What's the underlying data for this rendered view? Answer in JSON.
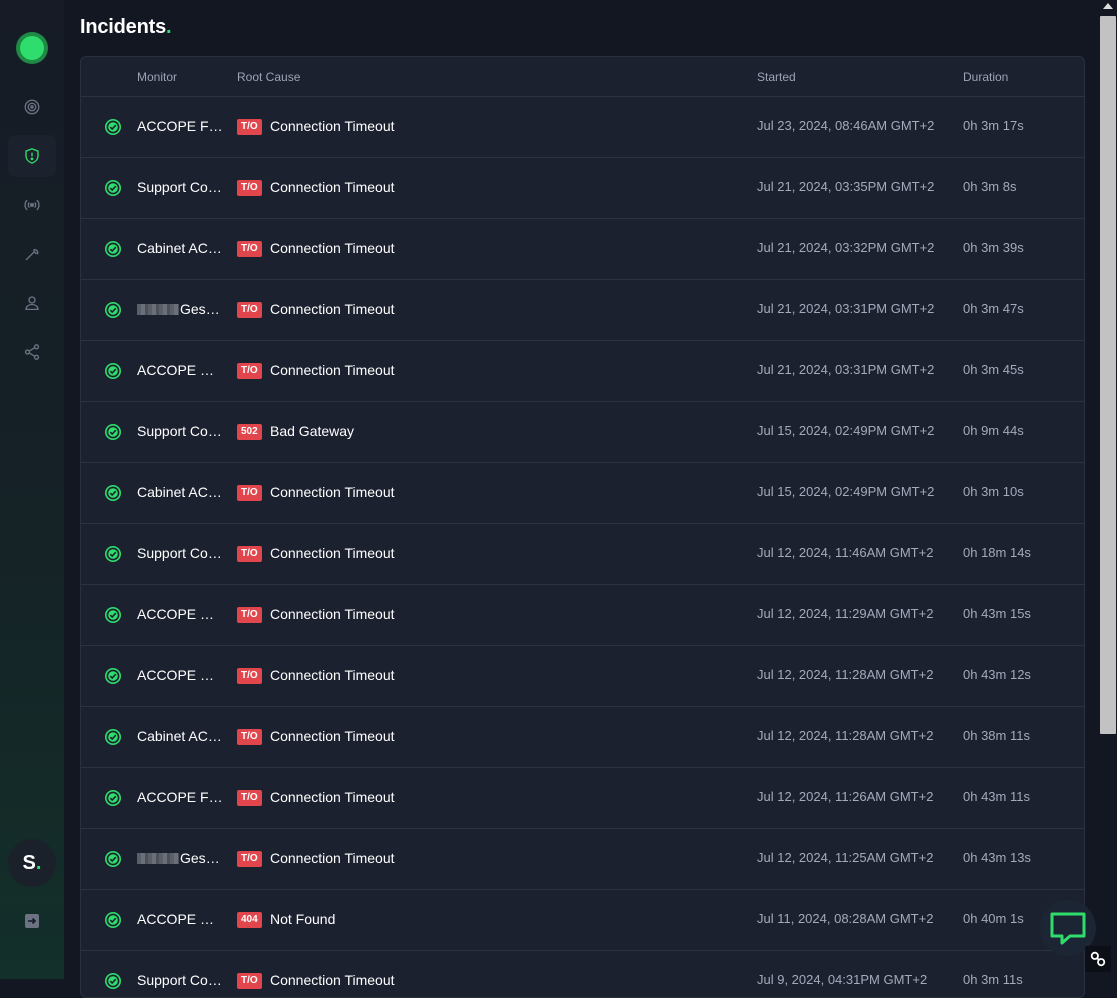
{
  "page": {
    "title": "Incidents",
    "title_dot": "."
  },
  "sidebar": {
    "items": [
      {
        "name": "sidebar-item-monitors",
        "icon": "target-icon",
        "active": false
      },
      {
        "name": "sidebar-item-incidents",
        "icon": "shield-alert-icon",
        "active": true
      },
      {
        "name": "sidebar-item-status",
        "icon": "broadcast-icon",
        "active": false
      },
      {
        "name": "sidebar-item-maintenance",
        "icon": "wrench-icon",
        "active": false
      },
      {
        "name": "sidebar-item-team",
        "icon": "user-icon",
        "active": false
      },
      {
        "name": "sidebar-item-integrations",
        "icon": "share-icon",
        "active": false
      }
    ],
    "avatar_letter": "S",
    "avatar_dot": ".",
    "accent_color": "#2fdd6c"
  },
  "table": {
    "headers": {
      "monitor": "Monitor",
      "root_cause": "Root Cause",
      "started": "Started",
      "duration": "Duration"
    },
    "rows": [
      {
        "status": "resolved",
        "monitor": "ACCOPE Flux",
        "redacted": false,
        "code": "T/O",
        "cause": "Connection Timeout",
        "started": "Jul 23, 2024, 08:46AM GMT+2",
        "duration": "0h 3m 17s"
      },
      {
        "status": "resolved",
        "monitor": "Support Co…",
        "redacted": false,
        "code": "T/O",
        "cause": "Connection Timeout",
        "started": "Jul 21, 2024, 03:35PM GMT+2",
        "duration": "0h 3m 8s"
      },
      {
        "status": "resolved",
        "monitor": "Cabinet AC…",
        "redacted": false,
        "code": "T/O",
        "cause": "Connection Timeout",
        "started": "Jul 21, 2024, 03:32PM GMT+2",
        "duration": "0h 3m 39s"
      },
      {
        "status": "resolved",
        "monitor": "Gesti…",
        "redacted": true,
        "code": "T/O",
        "cause": "Connection Timeout",
        "started": "Jul 21, 2024, 03:31PM GMT+2",
        "duration": "0h 3m 47s"
      },
      {
        "status": "resolved",
        "monitor": "ACCOPE Ga…",
        "redacted": false,
        "code": "T/O",
        "cause": "Connection Timeout",
        "started": "Jul 21, 2024, 03:31PM GMT+2",
        "duration": "0h 3m 45s"
      },
      {
        "status": "resolved",
        "monitor": "Support Co…",
        "redacted": false,
        "code": "502",
        "cause": "Bad Gateway",
        "started": "Jul 15, 2024, 02:49PM GMT+2",
        "duration": "0h 9m 44s"
      },
      {
        "status": "resolved",
        "monitor": "Cabinet AC…",
        "redacted": false,
        "code": "T/O",
        "cause": "Connection Timeout",
        "started": "Jul 15, 2024, 02:49PM GMT+2",
        "duration": "0h 3m 10s"
      },
      {
        "status": "resolved",
        "monitor": "Support Co…",
        "redacted": false,
        "code": "T/O",
        "cause": "Connection Timeout",
        "started": "Jul 12, 2024, 11:46AM GMT+2",
        "duration": "0h 18m 14s"
      },
      {
        "status": "resolved",
        "monitor": "ACCOPE Sit…",
        "redacted": false,
        "code": "T/O",
        "cause": "Connection Timeout",
        "started": "Jul 12, 2024, 11:29AM GMT+2",
        "duration": "0h 43m 15s"
      },
      {
        "status": "resolved",
        "monitor": "ACCOPE Ga…",
        "redacted": false,
        "code": "T/O",
        "cause": "Connection Timeout",
        "started": "Jul 12, 2024, 11:28AM GMT+2",
        "duration": "0h 43m 12s"
      },
      {
        "status": "resolved",
        "monitor": "Cabinet AC…",
        "redacted": false,
        "code": "T/O",
        "cause": "Connection Timeout",
        "started": "Jul 12, 2024, 11:28AM GMT+2",
        "duration": "0h 38m 11s"
      },
      {
        "status": "resolved",
        "monitor": "ACCOPE Flux",
        "redacted": false,
        "code": "T/O",
        "cause": "Connection Timeout",
        "started": "Jul 12, 2024, 11:26AM GMT+2",
        "duration": "0h 43m 11s"
      },
      {
        "status": "resolved",
        "monitor": "Gesti…",
        "redacted": true,
        "code": "T/O",
        "cause": "Connection Timeout",
        "started": "Jul 12, 2024, 11:25AM GMT+2",
        "duration": "0h 43m 13s"
      },
      {
        "status": "resolved",
        "monitor": "ACCOPE Ge…",
        "redacted": false,
        "code": "404",
        "cause": "Not Found",
        "started": "Jul 11, 2024, 08:28AM GMT+2",
        "duration": "0h 40m 1s"
      },
      {
        "status": "resolved",
        "monitor": "Support Co…",
        "redacted": false,
        "code": "T/O",
        "cause": "Connection Timeout",
        "started": "Jul 9, 2024, 04:31PM GMT+2",
        "duration": "0h 3m 11s"
      }
    ]
  },
  "colors": {
    "resolved": "#2fdd6c",
    "badge": "#e2464d"
  },
  "widgets": {
    "chat_icon": "chat-bubble-icon",
    "corner_icon": "link-icon"
  }
}
